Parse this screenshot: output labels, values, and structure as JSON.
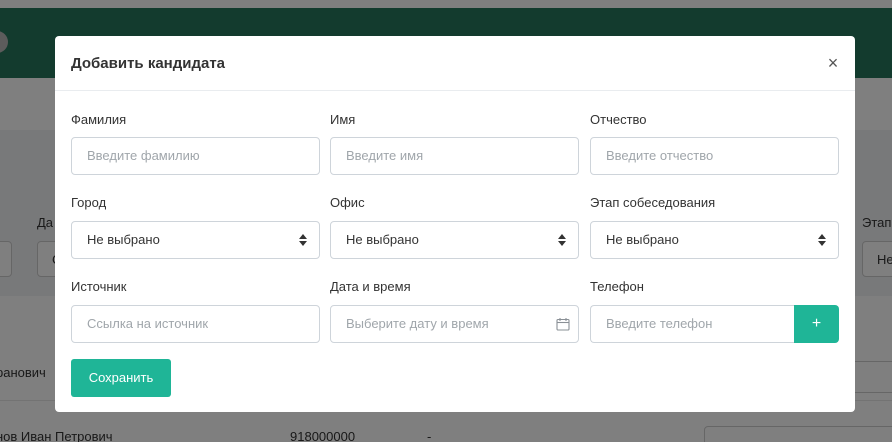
{
  "background": {
    "label_da": "Да",
    "label_etap": "Этап",
    "input_mid_text": "С",
    "input_right_text": "Не",
    "row1_name": "ранович",
    "row2_name": "нов Иван Петрович",
    "row2_phone": "918000000",
    "row2_dash": "-"
  },
  "modal": {
    "title": "Добавить кандидата",
    "close_glyph": "×",
    "fields": {
      "surname": {
        "label": "Фамилия",
        "placeholder": "Введите фамилию"
      },
      "name": {
        "label": "Имя",
        "placeholder": "Введите имя"
      },
      "patronymic": {
        "label": "Отчество",
        "placeholder": "Введите отчество"
      },
      "city": {
        "label": "Город",
        "value": "Не выбрано"
      },
      "office": {
        "label": "Офис",
        "value": "Не выбрано"
      },
      "stage": {
        "label": "Этап собеседования",
        "value": "Не выбрано"
      },
      "source": {
        "label": "Источник",
        "placeholder": "Ссылка на источник"
      },
      "datetime": {
        "label": "Дата и время",
        "placeholder": "Выберите дату и время"
      },
      "phone": {
        "label": "Телефон",
        "placeholder": "Введите телефон"
      }
    },
    "add_phone_label": "+",
    "save_label": "Сохранить"
  },
  "colors": {
    "header": "#27775c",
    "accent": "#1fb597"
  },
  "icons": [
    "close-icon",
    "sort-icon",
    "calendar-icon",
    "plus-icon"
  ]
}
